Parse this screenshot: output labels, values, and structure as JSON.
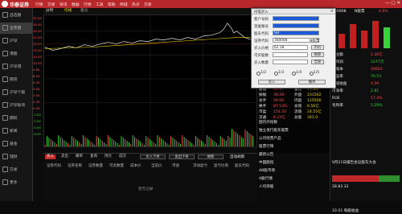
{
  "app": {
    "brand": "华泰证券"
  },
  "menu": [
    "行情",
    "交易",
    "资讯",
    "数据",
    "行情",
    "工具",
    "帮助",
    "商城",
    "热点",
    "交易"
  ],
  "sidebar": [
    {
      "label": "自选股",
      "icon": "star-icon"
    },
    {
      "label": "全景图",
      "icon": "grid-icon"
    },
    {
      "label": "沪深",
      "icon": "chart-icon"
    },
    {
      "label": "港股",
      "icon": "chart-icon"
    },
    {
      "label": "沪深港",
      "icon": "chart-icon"
    },
    {
      "label": "期货",
      "icon": "chart-icon"
    },
    {
      "label": "沪深个股",
      "icon": "chart-icon"
    },
    {
      "label": "沪深板块",
      "icon": "chart-icon"
    },
    {
      "label": "期权",
      "icon": "chart-icon"
    },
    {
      "label": "新闻",
      "icon": "news-icon"
    },
    {
      "label": "基金",
      "icon": "fund-icon"
    },
    {
      "label": "理财",
      "icon": "money-icon"
    },
    {
      "label": "交易",
      "icon": "trade-icon"
    },
    {
      "label": "更多",
      "icon": "more-icon"
    }
  ],
  "chartbar": {
    "left": "分时",
    "mid": "均线",
    "right": "叠加"
  },
  "leftquotes": [
    "35.55",
    "28.00",
    "24.50",
    "21.50",
    "20.00",
    "15.00",
    "14.00",
    "10.50",
    "9.60",
    "8.00",
    "6.50",
    "5.00",
    "3.50",
    "2.00",
    "0.00",
    "-2.00",
    "-3.50",
    "-5.00",
    "-6.50"
  ],
  "dialog": {
    "title": "闪电买入",
    "close": "×",
    "fields": [
      {
        "label": "客户号码",
        "value": ""
      },
      {
        "label": "资金账号",
        "value": ""
      },
      {
        "label": "股东代码",
        "value": "SH"
      },
      {
        "label": "证券代码",
        "value": "300008",
        "extra": "N股票"
      },
      {
        "label": "买入价格",
        "value": "62.18",
        "btn": "市价"
      },
      {
        "label": "可买股数",
        "value": "",
        "btn": "刷新"
      },
      {
        "label": "买入数量",
        "value": "",
        "btn": "全部"
      }
    ],
    "radios": [
      "1/2",
      "1/3",
      "1/4",
      "1/5"
    ],
    "buy": "买入",
    "cancel": "撤单"
  },
  "orderbook": {
    "rows": [
      {
        "l": "最高",
        "v": "18.65",
        "r": "开盘",
        "rv": "88.06"
      },
      {
        "l": "最低",
        "v": "43.67",
        "r": "量比",
        "rv": "77.10"
      },
      {
        "l": "振幅",
        "v": "39.28",
        "r": "外盘",
        "rv": "231562"
      },
      {
        "l": "总手",
        "v": "59.66",
        "r": "内盘",
        "rv": "125500"
      },
      {
        "l": "换手",
        "v": "87.53%",
        "r": "总值",
        "rv": "6.56亿"
      },
      {
        "l": "市盈",
        "v": "154.54",
        "r": "流值",
        "rv": "24.55亿"
      },
      {
        "l": "流通",
        "v": "6.23亿",
        "r": "总股",
        "rv": "341.0"
      }
    ],
    "news": [
      "国内外指数",
      "独立发行股东股票",
      "公司经营产品",
      "股票行情",
      "最新公告",
      "中国股指",
      "AB股市场",
      "A股行情",
      "人均持股",
      "人均市值"
    ]
  },
  "right": {
    "code": "300008",
    "name": "N股票",
    "change": "4.6%",
    "price": "62.18",
    "stats": [
      {
        "l": "营业额",
        "v": "2.36亿"
      },
      {
        "l": "净利润",
        "v": "1277万"
      },
      {
        "l": "总股本",
        "v": "20603"
      },
      {
        "l": "市盈率",
        "v": "70.53"
      },
      {
        "l": "每股收益",
        "v": "4.59"
      },
      {
        "l": "市净率",
        "v": "2.81"
      },
      {
        "l": "ROE",
        "v": "17.4%"
      },
      {
        "l": "毛利率",
        "v": "5.29%"
      }
    ],
    "news": [
      "9月21日报告会议股东大会",
      "28.83 33",
      "10-21 每股收益"
    ]
  },
  "bottom": {
    "tabs": [
      "买入",
      "卖出",
      "撤单",
      "查询",
      "持仓",
      "成交"
    ],
    "buttons": [
      "买入下单",
      "卖出下单",
      "刷新"
    ],
    "checkbox": "自动刷新",
    "cols": [
      "证券代码",
      "证券名称",
      "证券数量",
      "可卖数量",
      "成本价",
      "当前价",
      "市值",
      "浮动盈亏",
      "盈亏比例",
      "股东代码"
    ],
    "empty": "暂无记录"
  },
  "colors": {
    "accent": "#b8282a",
    "up": "#ff4d4d",
    "down": "#3ad13a",
    "line": "#e6e6e6",
    "avg": "#f0d000"
  }
}
